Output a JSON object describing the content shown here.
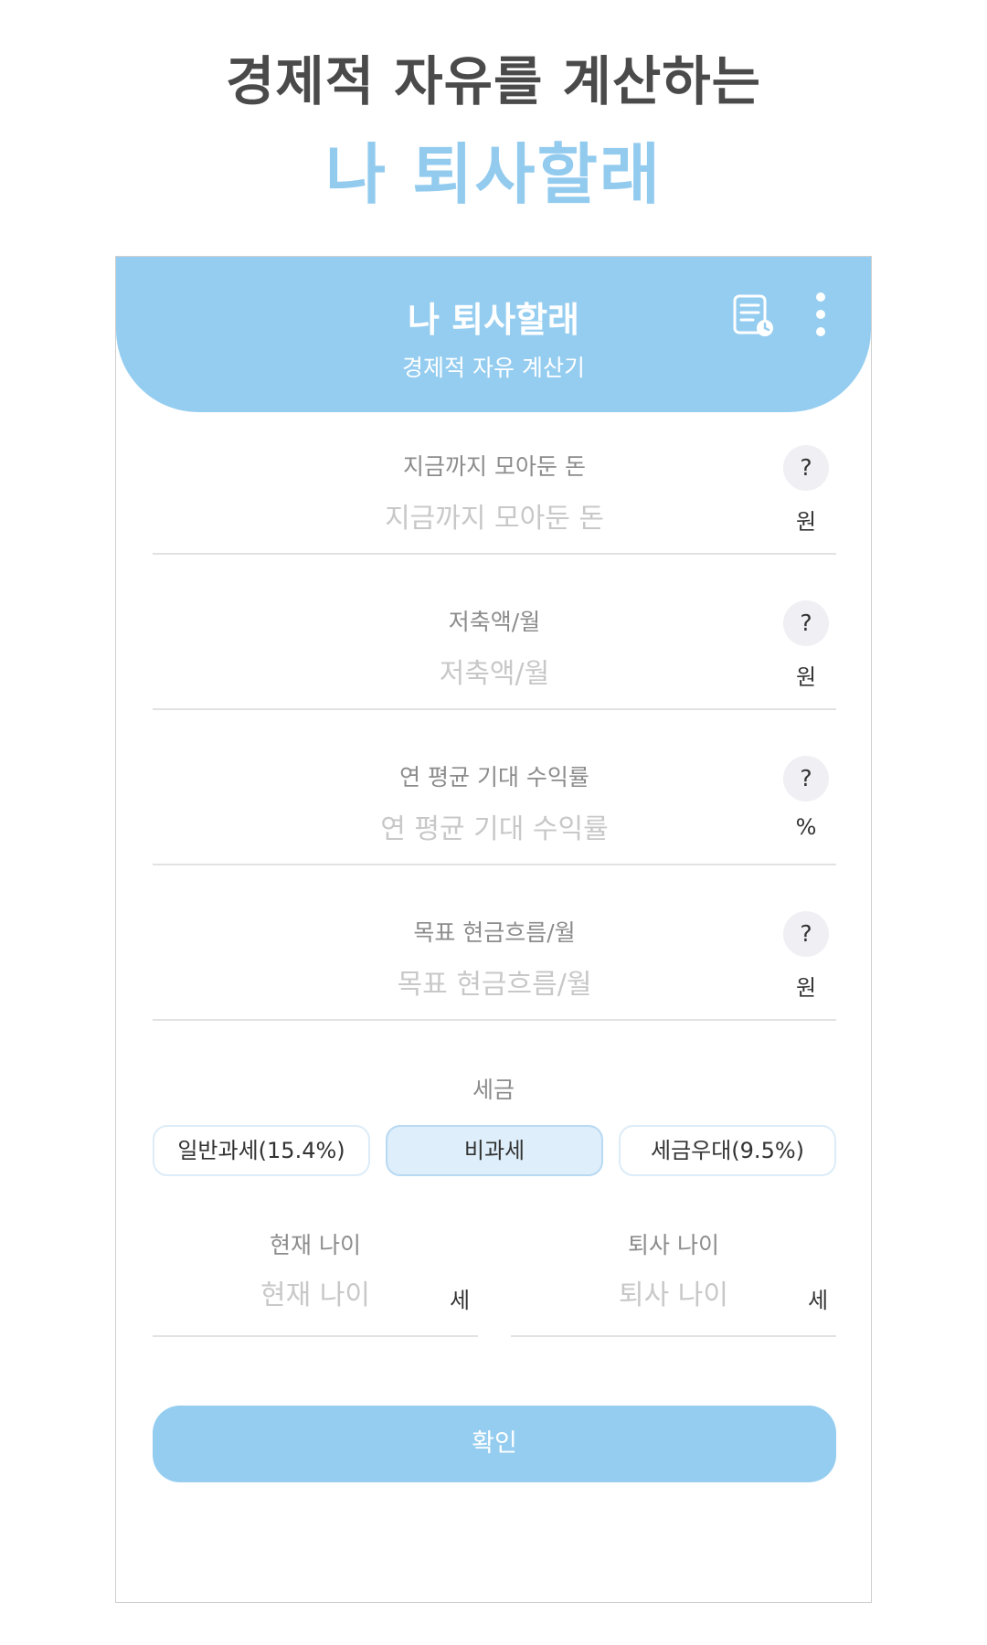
{
  "promo": {
    "line1": "경제적 자유를 계산하는",
    "line2": "나 퇴사할래"
  },
  "header": {
    "title": "나 퇴사할래",
    "subtitle": "경제적 자유 계산기",
    "icons": [
      "history-icon",
      "more-vertical-icon"
    ]
  },
  "fields": [
    {
      "label": "지금까지 모아둔 돈",
      "placeholder": "지금까지 모아둔 돈",
      "value": "",
      "unit": "원",
      "help": "?"
    },
    {
      "label": "저축액/월",
      "placeholder": "저축액/월",
      "value": "",
      "unit": "원",
      "help": "?"
    },
    {
      "label": "연 평균 기대 수익률",
      "placeholder": "연 평균 기대 수익률",
      "value": "",
      "unit": "%",
      "help": "?"
    },
    {
      "label": "목표 현금흐름/월",
      "placeholder": "목표 현금흐름/월",
      "value": "",
      "unit": "원",
      "help": "?"
    }
  ],
  "tax": {
    "label": "세금",
    "options": [
      "일반과세(15.4%)",
      "비과세",
      "세금우대(9.5%)"
    ],
    "selected": "비과세"
  },
  "ages": [
    {
      "label": "현재 나이",
      "placeholder": "현재 나이",
      "unit": "세"
    },
    {
      "label": "퇴사 나이",
      "placeholder": "퇴사 나이",
      "unit": "세"
    }
  ],
  "confirm_label": "확인",
  "colors": {
    "accent": "#95cdf0",
    "selected_bg": "#deeefa",
    "promo_dark": "#4a4a4a"
  }
}
